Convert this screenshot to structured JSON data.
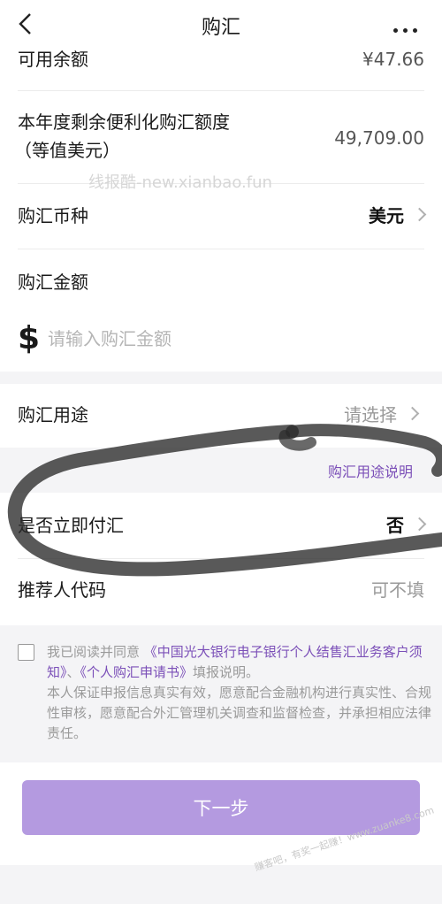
{
  "nav": {
    "title": "购汇"
  },
  "balance": {
    "label": "可用余额",
    "value": "¥47.66"
  },
  "quota": {
    "label_line1": "本年度剩余便利化购汇额度",
    "label_line2": "（等值美元）",
    "value": "49,709.00"
  },
  "watermark": "线报酷-new.xianbao.fun",
  "currency": {
    "label": "购汇币种",
    "value": "美元"
  },
  "amount": {
    "label": "购汇金额",
    "symbol": "$",
    "placeholder": "请输入购汇金额"
  },
  "purpose": {
    "label": "购汇用途",
    "value": "请选择",
    "link": "购汇用途说明"
  },
  "immediate": {
    "label": "是否立即付汇",
    "value": "否"
  },
  "referrer": {
    "label": "推荐人代码",
    "value": "可不填"
  },
  "agreement": {
    "prefix": "我已阅读并同意",
    "link1": "《中国光大银行电子银行个人结售汇业务客户须知》",
    "sep": "、",
    "link2": "《个人购汇申请书》",
    "suffix": "填报说明。",
    "pledge": "本人保证申报信息真实有效，愿意配合金融机构进行真实性、合规性审核，愿意配合外汇管理机关调查和监督检查，并承担相应法律责任。"
  },
  "next_button": "下一步",
  "corner_watermark": "赚客吧，有奖一起赚！www.zuanke8.com"
}
